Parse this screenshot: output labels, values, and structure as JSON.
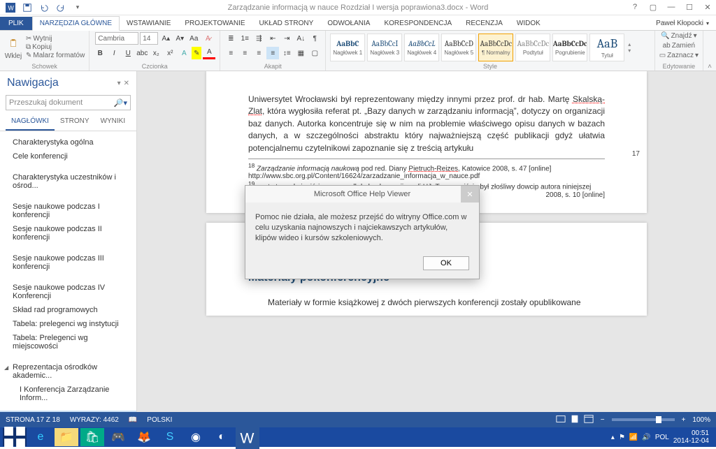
{
  "titlebar": {
    "title": "Zarządzanie informacją w nauce Rozdział I wersja poprawiona3.docx - Word"
  },
  "tabs": {
    "file": "PLIK",
    "home": "NARZĘDZIA GŁÓWNE",
    "insert": "WSTAWIANIE",
    "design": "PROJEKTOWANIE",
    "layout": "UKŁAD STRONY",
    "references": "ODWOŁANIA",
    "mailings": "KORESPONDENCJA",
    "review": "RECENZJA",
    "view": "WIDOK",
    "user": "Paweł Kłopocki"
  },
  "ribbon": {
    "clipboard": {
      "paste": "Wklej",
      "cut": "Wytnij",
      "copy": "Kopiuj",
      "painter": "Malarz formatów",
      "label": "Schowek"
    },
    "font": {
      "name": "Cambria",
      "size": "14",
      "label": "Czcionka"
    },
    "para": {
      "label": "Akapit"
    },
    "styles": {
      "label": "Style",
      "items": [
        {
          "sample": "AaBbC",
          "name": "Nagłówek 1"
        },
        {
          "sample": "AaBbCcI",
          "name": "Nagłówek 3"
        },
        {
          "sample": "AaBbCcL",
          "name": "Nagłówek 4"
        },
        {
          "sample": "AaBbCcD",
          "name": "Nagłówek 5"
        },
        {
          "sample": "AaBbCcDc",
          "name": "¶ Normalny"
        },
        {
          "sample": "AaBbCcDc",
          "name": "Podtytuł"
        },
        {
          "sample": "AaBbCcDc",
          "name": "Pogrubienie"
        },
        {
          "sample": "AaB",
          "name": "Tytuł"
        }
      ]
    },
    "editing": {
      "find": "Znajdź",
      "replace": "Zamień",
      "select": "Zaznacz",
      "label": "Edytowanie"
    }
  },
  "nav": {
    "title": "Nawigacja",
    "search_ph": "Przeszukaj dokument",
    "tabs": {
      "headings": "NAGŁÓWKI",
      "pages": "STRONY",
      "results": "WYNIKI"
    },
    "items": [
      "Charakterystyka ogólna",
      "Cele konferencji",
      "Charakterystyka uczestników i ośrod...",
      "Sesje naukowe podczas I konferencji",
      "Sesje naukowe podczas II konferencji",
      "Sesje naukowe podczas III konferencji",
      "Sesje naukowe podczas IV Konferencji",
      "Skład rad programowych",
      "Tabela: prelegenci wg instytucji",
      "Tabela: Prelegenci wg miejscowości",
      "Reprezentacja ośrodków akademic...",
      "I Konferencja Zarządzanie Inform...",
      "Materiały pokonferencyjne"
    ]
  },
  "doc": {
    "p1": "Uniwersytet Wrocławski był reprezentowany między innymi przez prof. dr hab. Martę ",
    "p1_u": "Skalską-Zlat",
    "p1b": ", która wygłosiła referat  pt. „Bazy danych w zarządzaniu informacją”, dotyczy on organizacji baz danych. Autorka koncentruje się w nim na problemie właściwego opisu danych w bazach danych, a w szczególności abstraktu który najważniejszą część publikacji gdyż ułatwia potencjalnemu czytelnikowi zapoznanie się z treścią artykułu",
    "f1a": "18",
    "f1b": " Zarządzanie informacją naukową ",
    "f1c": "pod red. Diany ",
    "f1d": "Pietruch-Reizes",
    "f1e": ", Katowice 2008, s. 47 [online] http://www.sbc.org.pl/Content/16624/zarzadzanie_informacja_w_nauce.pdf",
    "f2a": "19",
    "f2b": " warto tu nadmienić że przeszedł do konkurencji, czyli UJ. To oczywiście był złośliwy dowcip autora niniejszej",
    "f2c": "2008, s. 10 [online]",
    "page_num": "17",
    "h2": "Materiały pokonferencyjne",
    "p3": "Materiały w formie książkowej z dwóch pierwszych konferencji zostały opublikowane"
  },
  "dialog": {
    "title": "Microsoft Office Help Viewer",
    "body": "Pomoc nie działa, ale możesz przejść do witryny Office.com w celu uzyskania najnowszych i najciekawszych artykułów, klipów wideo i kursów szkoleniowych.",
    "ok": "OK"
  },
  "status": {
    "page": "STRONA 17 Z 18",
    "words": "WYRAZY: 4462",
    "lang": "POLSKI",
    "zoom": "100%"
  },
  "tray": {
    "vol": "",
    "lang": "POL",
    "time": "00:51",
    "date": "2014-12-04"
  }
}
